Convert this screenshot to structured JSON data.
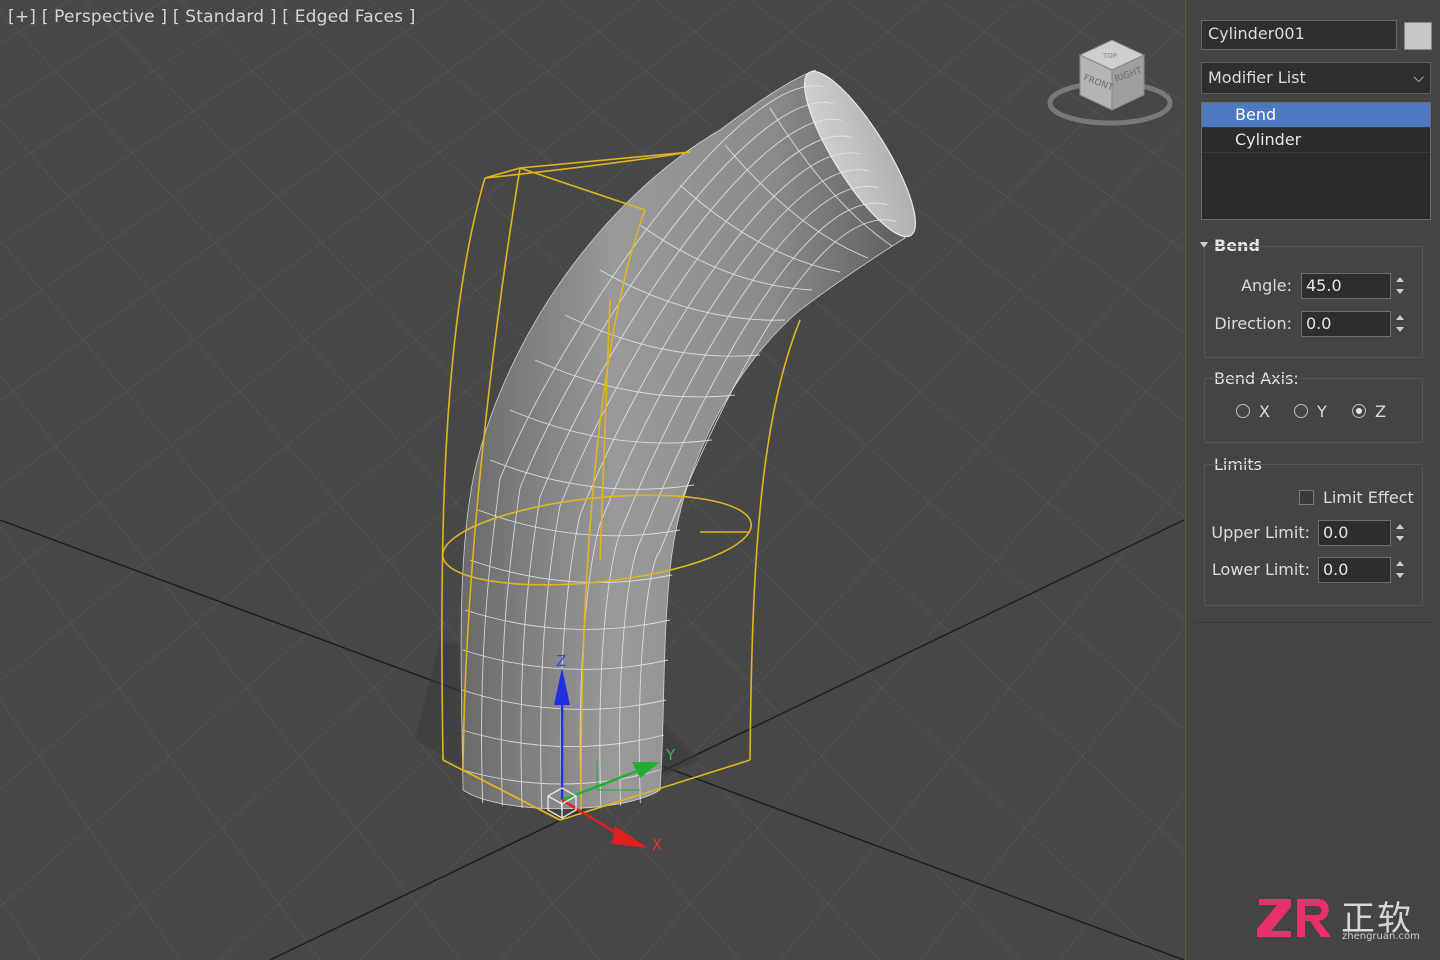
{
  "viewport": {
    "label_plus": "[+]",
    "label_view": "[ Perspective ]",
    "label_shading": "[ Standard ]",
    "label_mode": "[ Edged Faces ]",
    "viewcube_front": "FRONT",
    "viewcube_right": "RIGHT",
    "viewcube_top": "TOP",
    "axis_x": "X",
    "axis_y": "Y",
    "axis_z": "Z"
  },
  "panel": {
    "object_name": "Cylinder001",
    "color_swatch": "#c8c8c8",
    "modifier_list": "Modifier List",
    "stack": [
      {
        "label": "Bend",
        "selected": true
      },
      {
        "label": "Cylinder",
        "selected": false
      }
    ],
    "bend_section": "Bend",
    "angle_label": "Angle:",
    "angle_value": "45.0",
    "direction_label": "Direction:",
    "direction_value": "0.0",
    "bend_axis_label": "Bend Axis:",
    "axis_options": [
      {
        "label": "X",
        "selected": false
      },
      {
        "label": "Y",
        "selected": false
      },
      {
        "label": "Z",
        "selected": true
      }
    ],
    "limits_label": "Limits",
    "limit_effect_label": "Limit Effect",
    "limit_effect_checked": false,
    "upper_limit_label": "Upper Limit:",
    "upper_limit_value": "0.0",
    "lower_limit_label": "Lower Limit:",
    "lower_limit_value": "0.0"
  },
  "watermark": {
    "brand": "正软",
    "url": "zhengruan.com"
  },
  "colors": {
    "selection_bbox": "#e0b51e",
    "stack_highlight": "#4e78c0",
    "axis_x": "#e02020",
    "axis_y": "#20b030",
    "axis_z": "#2030e0"
  }
}
